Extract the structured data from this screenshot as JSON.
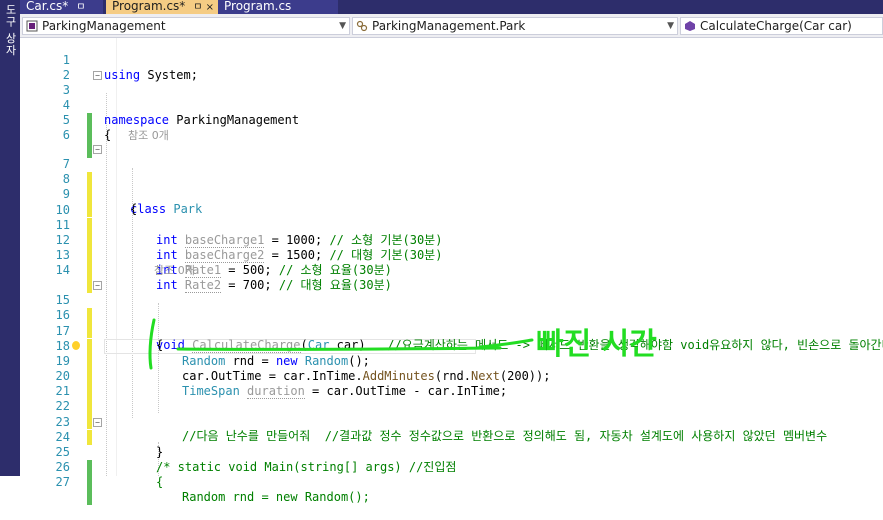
{
  "sidebar": {
    "label": "도구 상자"
  },
  "tabs": [
    {
      "label": "Car.cs*",
      "mark": "ㅁ"
    },
    {
      "label": "Program.cs*",
      "mark": "ㅁ ×"
    },
    {
      "label": "Program.cs",
      "mark": ""
    }
  ],
  "nav": {
    "project": "ParkingManagement",
    "class": "ParkingManagement.Park",
    "member": "CalculateCharge(Car car)"
  },
  "code": {
    "l1_using": "using",
    "l1_rest": " System;",
    "l3_ns": "namespace",
    "l3_name": " ParkingManagement",
    "l4": "{",
    "lens1": "참조 0개",
    "l7_class": "class",
    "l7_name": "Park",
    "l8": "{",
    "l10_int": "int",
    "l10_var": "baseCharge1",
    "l10_val": " = 1000; ",
    "l10_cm": "// 소형 기본(30분)",
    "l11_int": "int",
    "l11_var": "baseCharge2",
    "l11_val": " = 1500; ",
    "l11_cm": "// 대형 기본(30분)",
    "l12_int": "int",
    "l12_var": "Rate1",
    "l12_val": " = 500; ",
    "l12_cm": "// 소형 요율(30분)",
    "l13_int": "int",
    "l13_var": "Rate2",
    "l13_val": " = 700; ",
    "l13_cm": "// 대형 요율(30분)",
    "lens2": "참조 0개",
    "l15_void": "void",
    "l15_fn": "CalculateCharge",
    "l15_p1": "(",
    "l15_type": "Car",
    "l15_p2": " car)   ",
    "l15_cm": "//요금계산하는 메서드 -> 메서드 반환을 생각해야함 void유요하지 않다, 빈손으로 돌아간다",
    "l16": "{",
    "l17_ty": "Random",
    "l17_mid": " rnd = ",
    "l17_new": "new",
    "l17_ty2": "Random",
    "l17_end": "();",
    "l18_a": "car.OutTime = car.InTime.",
    "l18_fn": "AddMinutes",
    "l18_b": "(rnd.",
    "l18_fn2": "Next",
    "l18_c": "(200));",
    "l19_ty": "TimeSpan",
    "l19_var": "duration",
    "l19_rest": " = car.OutTime - car.InTime;",
    "l22_cm": "//다음 난수를 만들어줘  //결과값 정수 정수값으로 반환으로 정의해도 됨, 자동차 설계도에 사용하지 않았던 멤버변수",
    "l23": "}",
    "l24_cm": "/* static void Main(string[] args) //진입점",
    "l25_cm": "{",
    "l26_cm": "Random rnd = new Random();"
  },
  "annotation": {
    "text": "빠진 시간",
    "color": "#22dd22"
  },
  "colors": {
    "keyword": "#0000ff",
    "type": "#2b91af",
    "comment": "#008000",
    "linenum": "#2b91af",
    "tab_active": "#f5cc84",
    "changed_saved": "#5bbd5b",
    "changed_unsaved": "#f0e63c"
  },
  "line_numbers": [
    "1",
    "2",
    "3",
    "4",
    "5",
    "6",
    "7",
    "8",
    "9",
    "10",
    "11",
    "12",
    "13",
    "14",
    "15",
    "16",
    "17",
    "18",
    "19",
    "20",
    "21",
    "22",
    "23",
    "24",
    "25",
    "26",
    "27"
  ]
}
